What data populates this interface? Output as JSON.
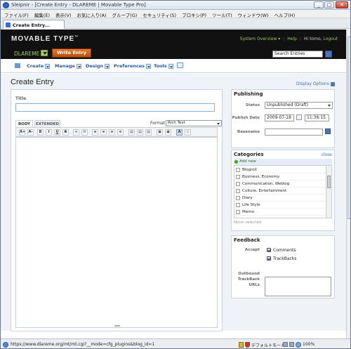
{
  "window": {
    "title": "Sleipnir - [Create Entry - DLAREME | Movable Type Pro]",
    "min": "_",
    "max": "□",
    "close": "✕"
  },
  "menubar": [
    "ファイル(F)",
    "編集(E)",
    "表示(V)",
    "お気に入り(A)",
    "グループ(G)",
    "セキュリティ(S)",
    "プロキシ(P)",
    "ツール(T)",
    "ウィンドウ(W)",
    "ヘルプ(H)"
  ],
  "tab": {
    "label": "Create Entry..."
  },
  "mt_header": {
    "logo": "MOVABLE TYPE",
    "logo_tm": "™",
    "system_overview": "System Overview ▾",
    "help": "Help",
    "user": "Hi tomo,",
    "logout": "Logout",
    "blog_name": "DLAREME",
    "write_entry": "Write Entry",
    "search_placeholder": "Search Entries"
  },
  "nav": [
    "Create",
    "Manage",
    "Design",
    "Preferences",
    "Tools"
  ],
  "page": {
    "title": "Create Entry",
    "display_options": "Display Options"
  },
  "editor": {
    "title_label": "Title",
    "title_value": "",
    "tab_body": "BODY",
    "tab_extended": "EXTENDED",
    "format_label": "Format",
    "format_value": "Rich Text",
    "toolbar": [
      "A+",
      "A-",
      "B",
      "I",
      "U",
      "S",
      "∞",
      "✉",
      "≡",
      "≡",
      "≡",
      "≡",
      "▤",
      "▤",
      "▤",
      "▣",
      "▣",
      "A",
      "◇"
    ]
  },
  "publishing": {
    "heading": "Publishing",
    "status_label": "Status",
    "status_value": "Unpublished (Draft)",
    "date_label": "Publish Date",
    "date_value": "2009-07-18",
    "time_value": "11:36:15",
    "basename_label": "Basename"
  },
  "categories": {
    "heading": "Categories",
    "close": "close",
    "add_new": "Add new",
    "items": [
      "Blogroll",
      "Business, Economy",
      "Communication, Weblog",
      "Culture, Entertainment",
      "Diary",
      "Life Style",
      "Memo"
    ],
    "none_selected": "None selected"
  },
  "feedback": {
    "heading": "Feedback",
    "accept_label": "Accept",
    "comments": "Comments",
    "trackbacks": "TrackBacks",
    "outbound_label": "Outbound TrackBack URLs"
  },
  "statusbar": {
    "url": "https://www.dlareme.org/mt/mt.cgi?__mode=cfg_plugins&blog_id=1",
    "mode": "デフォルトモード",
    "zoom": "100%"
  }
}
